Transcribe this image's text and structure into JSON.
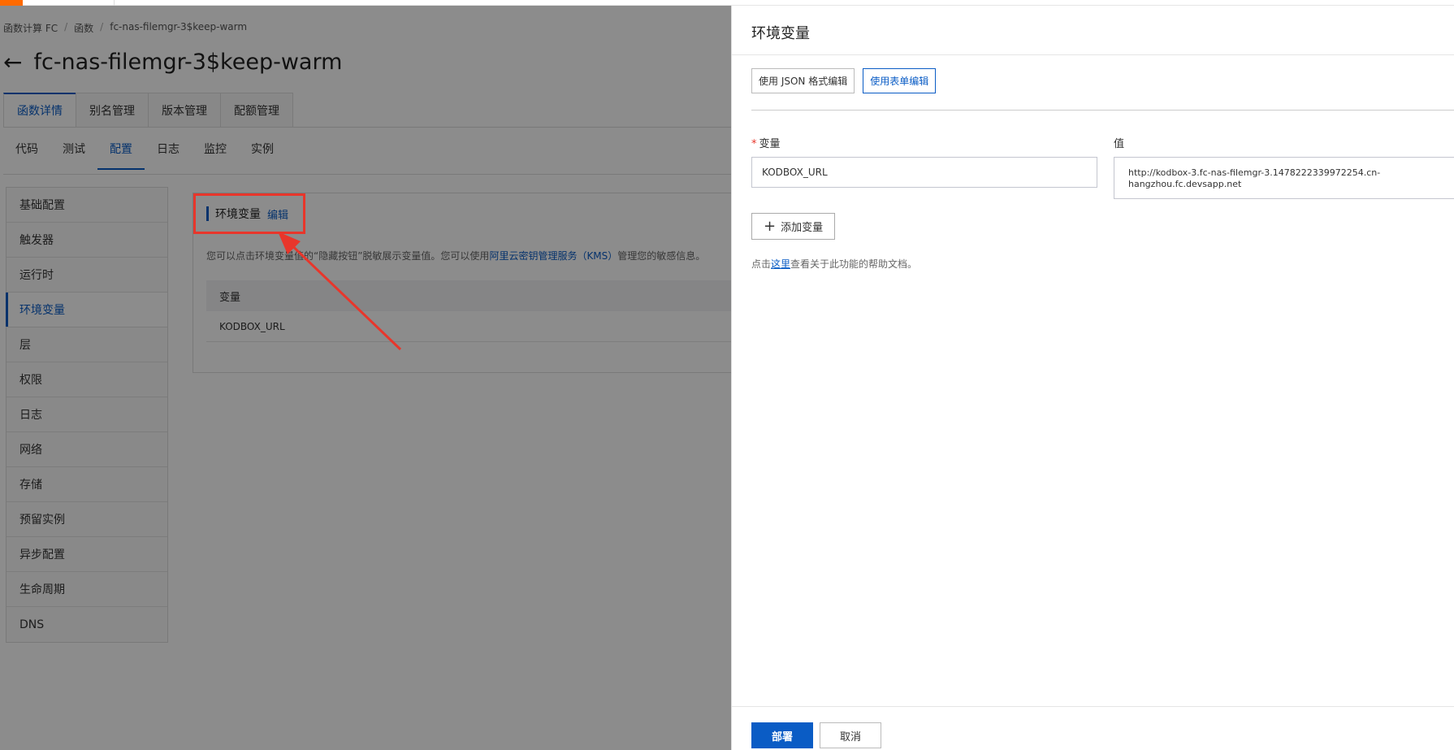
{
  "breadcrumb": [
    "函数计算 FC",
    "函数",
    "fc-nas-filemgr-3$keep-warm"
  ],
  "page_title": "fc-nas-filemgr-3$keep-warm",
  "main_tabs": [
    "函数详情",
    "别名管理",
    "版本管理",
    "配额管理"
  ],
  "sub_tabs": [
    "代码",
    "测试",
    "配置",
    "日志",
    "监控",
    "实例"
  ],
  "sidenav": [
    "基础配置",
    "触发器",
    "运行时",
    "环境变量",
    "层",
    "权限",
    "日志",
    "网络",
    "存储",
    "预留实例",
    "异步配置",
    "生命周期",
    "DNS"
  ],
  "card": {
    "title": "环境变量",
    "edit": "编辑",
    "desc_before": "您可以点击环境变量值的“隐藏按钮”脱敏展示变量值。您可以使用",
    "desc_link": "阿里云密钥管理服务（KMS）",
    "desc_after": "管理您的敏感信息。",
    "table_header": "变量",
    "table_rows": [
      "KODBOX_URL"
    ]
  },
  "drawer": {
    "title": "环境变量",
    "mode_json": "使用 JSON 格式编辑",
    "mode_form": "使用表单编辑",
    "label_var": "变量",
    "required_mark": "*",
    "label_val": "值",
    "var_value": "KODBOX_URL",
    "val_value": "http://kodbox-3.fc-nas-filemgr-3.1478222339972254.cn-\nhangzhou.fc.devsapp.net",
    "add_var": "添加变量",
    "help_before": "点击",
    "help_link": "这里",
    "help_after": "查看关于此功能的帮助文档。",
    "deploy": "部署",
    "cancel": "取消"
  },
  "colors": {
    "accent": "#0a5cc5",
    "annotation": "#e8362b",
    "brand": "#ff6a00"
  }
}
